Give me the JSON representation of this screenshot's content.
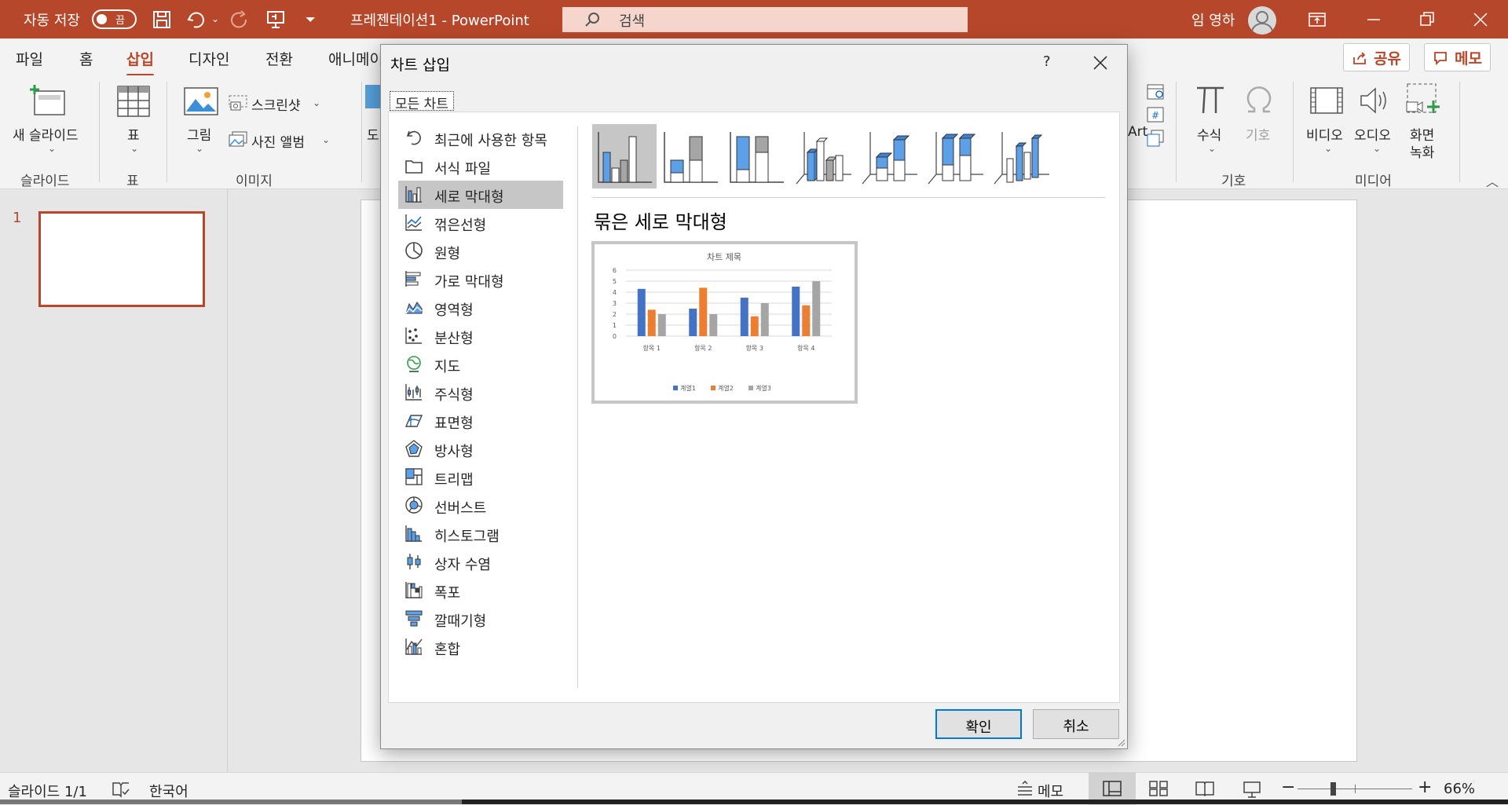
{
  "titlebar": {
    "autosave_label": "자동 저장",
    "autosave_state": "끔",
    "title": "프레젠테이션1  -  PowerPoint",
    "search_placeholder": "검색",
    "user_name": "임 영하"
  },
  "tabs": [
    "파일",
    "홈",
    "삽입",
    "디자인",
    "전환",
    "애니메이션"
  ],
  "active_tab": "삽입",
  "share_label": "공유",
  "comment_label": "메모",
  "ribbon": {
    "new_slide": "새 슬라이드",
    "table": "표",
    "pictures": "그림",
    "screenshot": "스크린샷",
    "photo_album": "사진 앨범",
    "shapes_partial": "도",
    "smartart_partial": "Art",
    "equation": "수식",
    "symbol": "기호",
    "video": "비디오",
    "audio": "오디오",
    "screen_recording": "화면 녹화",
    "groups": {
      "slides": "슬라이드",
      "tables": "표",
      "images": "이미지",
      "symbols": "기호",
      "media": "미디어"
    }
  },
  "slide_number": "1",
  "statusbar": {
    "slide_count": "슬라이드 1/1",
    "language": "한국어",
    "notes": "메모",
    "zoom": "66%"
  },
  "dialog": {
    "title": "차트 삽입",
    "help": "?",
    "tab_all": "모든 차트",
    "chart_types": [
      "최근에 사용한 항목",
      "서식 파일",
      "세로 막대형",
      "꺾은선형",
      "원형",
      "가로 막대형",
      "영역형",
      "분산형",
      "지도",
      "주식형",
      "표면형",
      "방사형",
      "트리맵",
      "선버스트",
      "히스토그램",
      "상자 수염",
      "폭포",
      "깔때기형",
      "혼합"
    ],
    "selected_type": "세로 막대형",
    "subtype_title": "묶은 세로 막대형",
    "ok": "확인",
    "cancel": "취소"
  },
  "chart_data": {
    "type": "bar",
    "title": "차트 제목",
    "categories": [
      "항목 1",
      "항목 2",
      "항목 3",
      "항목 4"
    ],
    "series": [
      {
        "name": "계열1",
        "values": [
          4.3,
          2.5,
          3.5,
          4.5
        ],
        "color": "#4472c4"
      },
      {
        "name": "계열2",
        "values": [
          2.4,
          4.4,
          1.8,
          2.8
        ],
        "color": "#ed7d31"
      },
      {
        "name": "계열3",
        "values": [
          2,
          2,
          3,
          5
        ],
        "color": "#a5a5a5"
      }
    ],
    "yticks": [
      "0",
      "1",
      "2",
      "3",
      "4",
      "5",
      "6"
    ],
    "ylim": [
      0,
      6
    ],
    "grid": true,
    "legend": "bottom"
  },
  "colors": {
    "accent": "#b7472a",
    "dialog_focus": "#0078d7"
  }
}
